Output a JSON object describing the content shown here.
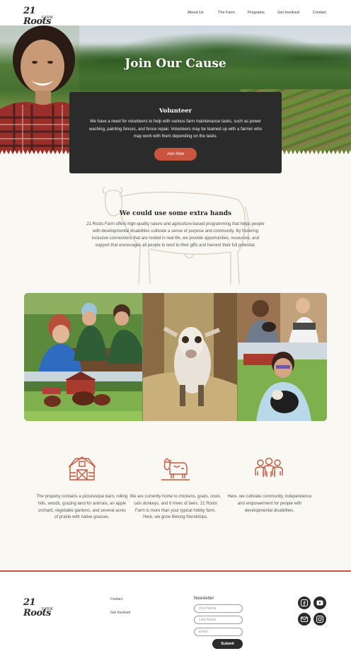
{
  "brand": {
    "name_line1": "21 Roots",
    "name_line2": "FARM"
  },
  "nav": {
    "items": [
      "About Us",
      "The Farm",
      "Programs",
      "Get Involved",
      "Contact"
    ]
  },
  "hero": {
    "title": "Join Our Cause"
  },
  "volunteer": {
    "title": "Volunteer",
    "body": "We have a need for volunteers to help with various farm maintenance tasks, such as power washing, painting fences, and fence repair. Volunteers may be teamed up with a farmer who may work with them depending on the tasks.",
    "button": "Join Now"
  },
  "extra_hands": {
    "title": "We could use some extra hands",
    "body": "21 Roots Farm offers high-quality nature and agriculture-based programming that helps people with developmental disabilities cultivate a sense of purpose and community. By fostering inclusive connections that are rooted in real life, we provide opportunities, resources, and support that encourages all people to tend to their gifts and harvest their full potential."
  },
  "features": [
    {
      "icon": "barn-icon",
      "text": "The property contains a picturesque barn, rolling hills, woods, grazing land for animals, an apple orchard, vegetable gardens, and several acres of prairie with native grasses."
    },
    {
      "icon": "cow-icon",
      "text": "We are currently home to chickens, goats, cows, cats donkeys, and 6 hives of bees. 21 Roots Farm is more than your typical hobby farm. Here, we grow lifelong friendships."
    },
    {
      "icon": "people-icon",
      "text": "Here, we cultivate community, independence and empowerment for people with developmental disabilities."
    }
  ],
  "footer": {
    "links": [
      "Contact",
      "Get Involved"
    ],
    "newsletter": {
      "title": "Newsletter",
      "first_name_placeholder": "First Name",
      "last_name_placeholder": "Last Name",
      "email_placeholder": "Email",
      "submit": "Submit"
    },
    "social": [
      "facebook-icon",
      "youtube-icon",
      "email-icon",
      "instagram-icon"
    ]
  },
  "colors": {
    "accent": "#c8553d",
    "dark": "#2b2b2b",
    "background": "#faf8f3"
  }
}
